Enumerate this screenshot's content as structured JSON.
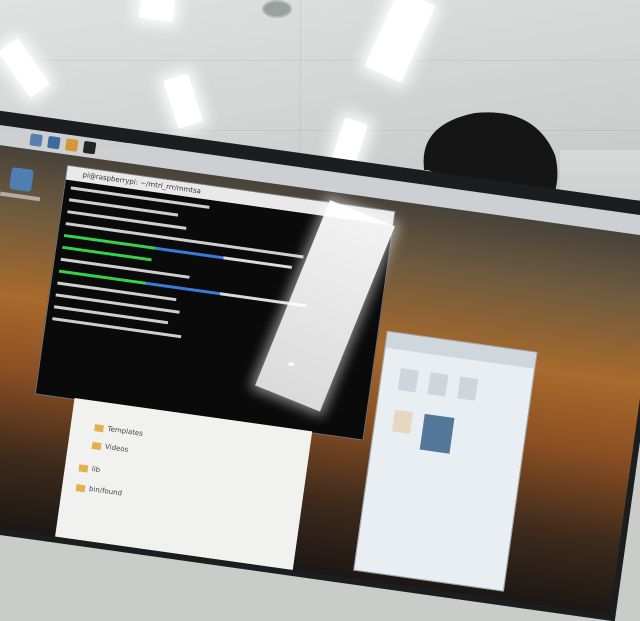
{
  "scene": {
    "description_tag": "photo-of-monitor",
    "colors": {
      "ceiling": "#d6d9d7",
      "monitor_bezel": "#1b1d1e",
      "wallpaper_orange": "#a86a2c",
      "terminal_bg": "#0a0a0a",
      "terminal_green": "#37d04a",
      "terminal_white": "#dcdcdc",
      "terminal_blue": "#3a7bd5",
      "hair": "#151515"
    }
  },
  "terminal": {
    "title": "pi@raspberrypi: ~/mtrl_rrr/mmtsa"
  },
  "file_sidebar": {
    "items": [
      "Templates",
      "Videos",
      "lib",
      "bin/found"
    ]
  }
}
